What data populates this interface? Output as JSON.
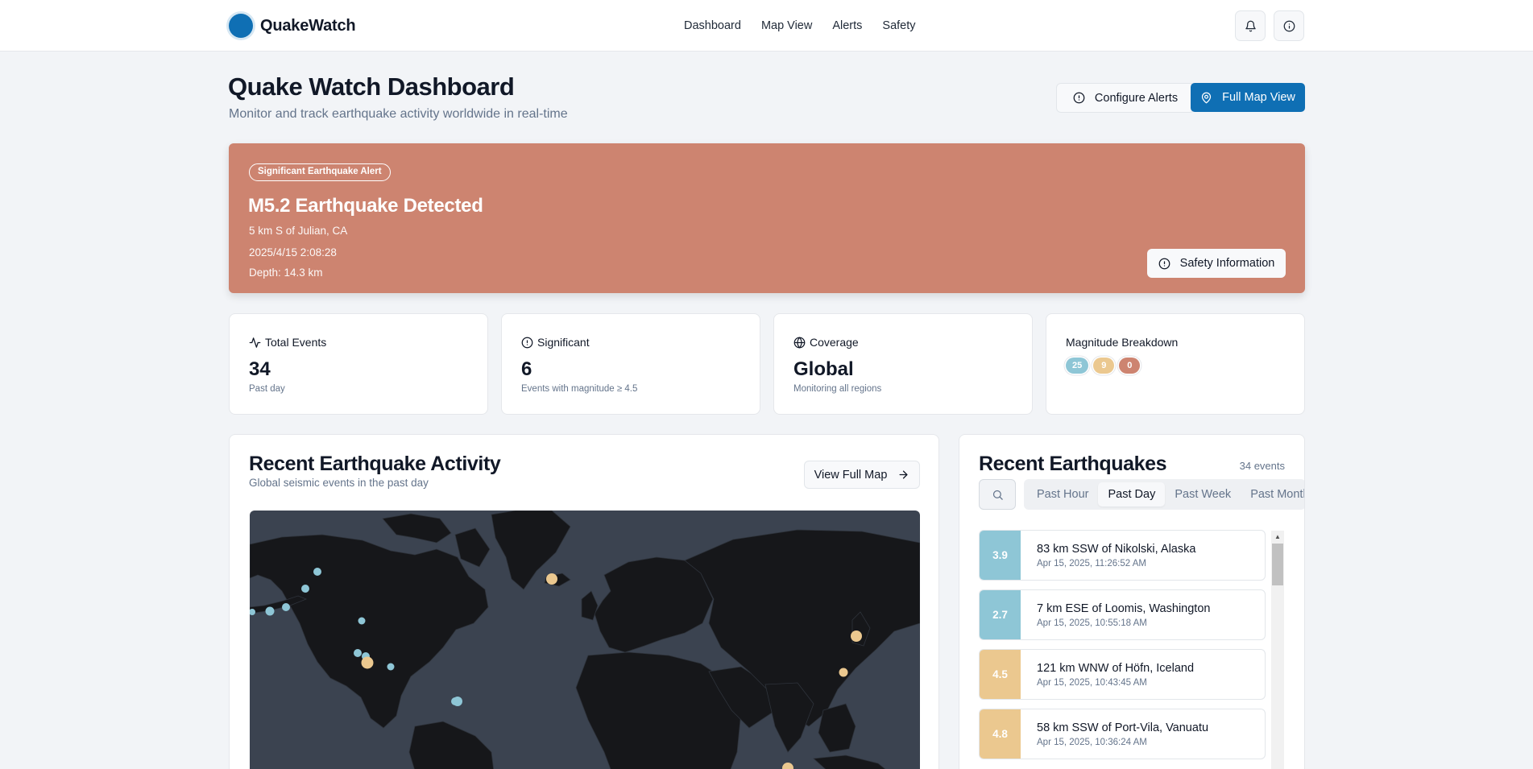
{
  "header": {
    "brand": "QuakeWatch",
    "nav": [
      "Dashboard",
      "Map View",
      "Alerts",
      "Safety"
    ],
    "icons": [
      "bell-icon",
      "info-icon"
    ]
  },
  "page": {
    "title": "Quake Watch Dashboard",
    "subtitle": "Monitor and track earthquake activity worldwide in real-time",
    "configure_label": "Configure Alerts",
    "full_map_label": "Full Map View"
  },
  "alert": {
    "badge": "Significant Earthquake Alert",
    "title": "M5.2 Earthquake Detected",
    "location": "5 km S of Julian, CA",
    "time": "2025/4/15 2:08:28",
    "depth": "Depth: 14.3 km",
    "button": "Safety Information",
    "color": "#cd8470"
  },
  "stats": [
    {
      "label": "Total Events",
      "value": "34",
      "sub": "Past day",
      "icon": "activity-icon"
    },
    {
      "label": "Significant",
      "value": "6",
      "sub": "Events with magnitude ≥ 4.5",
      "icon": "alert-circle-icon"
    },
    {
      "label": "Coverage",
      "value": "Global",
      "sub": "Monitoring all regions",
      "icon": "globe-icon"
    }
  ],
  "breakdown": {
    "label": "Magnitude Breakdown",
    "pills": [
      {
        "value": "25",
        "color": "#8ec6d6"
      },
      {
        "value": "9",
        "color": "#ebc88f"
      },
      {
        "value": "0",
        "color": "#cd8470"
      }
    ]
  },
  "map_card": {
    "title": "Recent Earthquake Activity",
    "subtitle": "Global seismic events in the past day",
    "button": "View Full Map"
  },
  "recent": {
    "title": "Recent Earthquakes",
    "count": "34 events",
    "tabs": [
      "Past Hour",
      "Past Day",
      "Past Week",
      "Past Month"
    ],
    "active_tab": "Past Day",
    "items": [
      {
        "mag": "3.9",
        "place": "83 km SSW of Nikolski, Alaska",
        "time": "Apr 15, 2025, 11:26:52 AM",
        "color": "#8ec6d6"
      },
      {
        "mag": "2.7",
        "place": "7 km ESE of Loomis, Washington",
        "time": "Apr 15, 2025, 10:55:18 AM",
        "color": "#8ec6d6"
      },
      {
        "mag": "4.5",
        "place": "121 km WNW of Höfn, Iceland",
        "time": "Apr 15, 2025, 10:43:45 AM",
        "color": "#ebc88f"
      },
      {
        "mag": "4.8",
        "place": "58 km SSW of Port-Vila, Vanuatu",
        "time": "Apr 15, 2025, 10:36:24 AM",
        "color": "#ebc88f"
      }
    ]
  }
}
